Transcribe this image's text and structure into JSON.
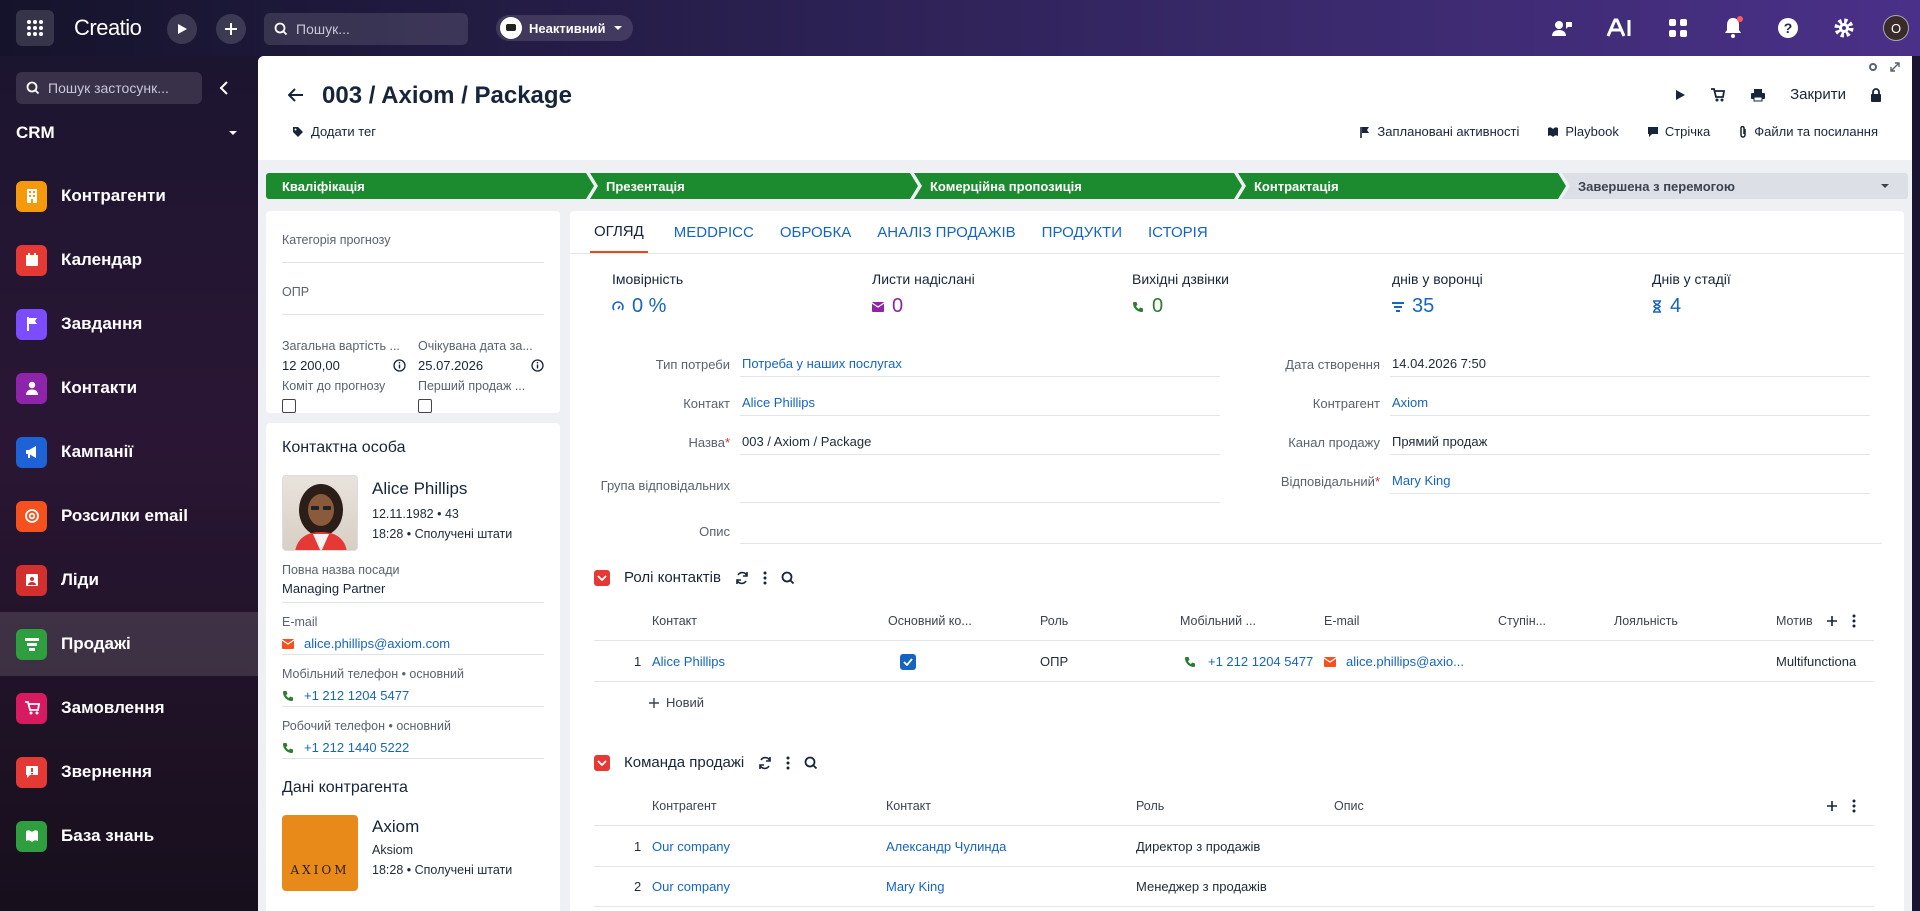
{
  "topbar": {
    "app_name": "Creatio",
    "search_placeholder": "Пошук...",
    "status": "Неактивний",
    "user_initial": "O"
  },
  "sidebar": {
    "search_placeholder": "Пошук застосунк...",
    "workspace": "CRM",
    "items": [
      {
        "label": "Контрагенти",
        "color": "#f59a0c",
        "icon": "building-icon"
      },
      {
        "label": "Календар",
        "color": "#e53935",
        "icon": "calendar-icon"
      },
      {
        "label": "Завдання",
        "color": "#7c4dff",
        "icon": "flag-icon"
      },
      {
        "label": "Контакти",
        "color": "#8e24aa",
        "icon": "person-icon"
      },
      {
        "label": "Кампанії",
        "color": "#1e63d6",
        "icon": "megaphone-icon"
      },
      {
        "label": "Розсилки email",
        "color": "#f4511e",
        "icon": "at-icon"
      },
      {
        "label": "Ліди",
        "color": "#d32f2f",
        "icon": "leads-icon"
      },
      {
        "label": "Продажі",
        "color": "#2e9e3e",
        "icon": "funnel-icon"
      },
      {
        "label": "Замовлення",
        "color": "#d81b60",
        "icon": "cart-icon"
      },
      {
        "label": "Звернення",
        "color": "#e53935",
        "icon": "chat-alert-icon"
      },
      {
        "label": "База знань",
        "color": "#2e9e3e",
        "icon": "book-icon"
      }
    ]
  },
  "header": {
    "title": "003 / Axiom / Package",
    "add_tag": "Додати тег",
    "close": "Закрити",
    "links": [
      "Заплановані активності",
      "Playbook",
      "Стрічка",
      "Файли та посилання"
    ]
  },
  "stages": [
    "Кваліфікація",
    "Презентація",
    "Комерційна пропозиція",
    "Контрактація",
    "Завершена з перемогою"
  ],
  "left_panel": {
    "forecast_category": "Категорія прогнозу",
    "opr": "ОПР",
    "total_label": "Загальна вартість ...",
    "total_value": "12 200,00",
    "close_label": "Очікувана дата за...",
    "close_value": "25.07.2026",
    "commit_label": "Коміт до прогнозу",
    "first_sale_label": "Перший продаж ..."
  },
  "contact": {
    "section": "Контактна особа",
    "name": "Alice Phillips",
    "birth": "12.11.1982 • 43",
    "time": "18:28 • Сполучені штати",
    "job_label": "Повна назва посади",
    "job_value": "Managing Partner",
    "email_label": "E-mail",
    "email_value": "alice.phillips@axiom.com",
    "mobile_label": "Мобільний телефон • основний",
    "mobile_value": "+1 212 1204 5477",
    "work_label": "Робочий телефон • основний",
    "work_value": "+1 212 1440 5222"
  },
  "account": {
    "section": "Дані контрагента",
    "name": "Axiom",
    "alt": "Aksiom",
    "logo_text": "AXIOM",
    "time": "18:28 • Сполучені штати"
  },
  "tabs": [
    "ОГЛЯД",
    "MEDDPICC",
    "ОБРОБКА",
    "АНАЛІЗ ПРОДАЖІВ",
    "ПРОДУКТИ",
    "ІСТОРІЯ"
  ],
  "kpis": [
    {
      "label": "Імовірність",
      "value": "0 %",
      "color": "#1565c0"
    },
    {
      "label": "Листи надіслані",
      "value": "0",
      "color": "#8e24aa"
    },
    {
      "label": "Вихідні дзвінки",
      "value": "0",
      "color": "#2e7d32"
    },
    {
      "label": "днів у воронці",
      "value": "35",
      "color": "#1565c0"
    },
    {
      "label": "Днів у стадії",
      "value": "4",
      "color": "#1565c0"
    }
  ],
  "fields_left": [
    {
      "label": "Тип потреби",
      "value": "Потреба у наших послугах",
      "link": true
    },
    {
      "label": "Контакт",
      "value": "Alice Phillips",
      "link": true
    },
    {
      "label": "Назва",
      "value": "003 / Axiom / Package",
      "required": true
    },
    {
      "label": "Група відповідальних",
      "value": ""
    },
    {
      "label": "Опис",
      "value": ""
    }
  ],
  "fields_right": [
    {
      "label": "Дата створення",
      "value": "14.04.2026 7:50"
    },
    {
      "label": "Контрагент",
      "value": "Axiom",
      "link": true
    },
    {
      "label": "Канал продажу",
      "value": "Прямий продаж"
    },
    {
      "label": "Відповідальний",
      "value": "Mary King",
      "link": true,
      "required": true
    }
  ],
  "roles": {
    "title": "Ролі контактів",
    "columns": [
      "Контакт",
      "Основний ко...",
      "Роль",
      "Мобільний ...",
      "E-mail",
      "Ступін...",
      "Лояльність",
      "Мотив"
    ],
    "row": {
      "num": "1",
      "contact": "Alice Phillips",
      "role": "ОПР",
      "mobile": "+1 212 1204 5477",
      "email": "alice.phillips@axio...",
      "motive": "Multifunctiona"
    },
    "new": "Новий"
  },
  "team": {
    "title": "Команда продажі",
    "columns": [
      "Контрагент",
      "Контакт",
      "Роль",
      "Опис"
    ],
    "rows": [
      {
        "num": "1",
        "account": "Our company",
        "contact": "Александр Чулинда",
        "role": "Директор з продажів"
      },
      {
        "num": "2",
        "account": "Our company",
        "contact": "Mary King",
        "role": "Менеджер з продажів"
      }
    ]
  }
}
